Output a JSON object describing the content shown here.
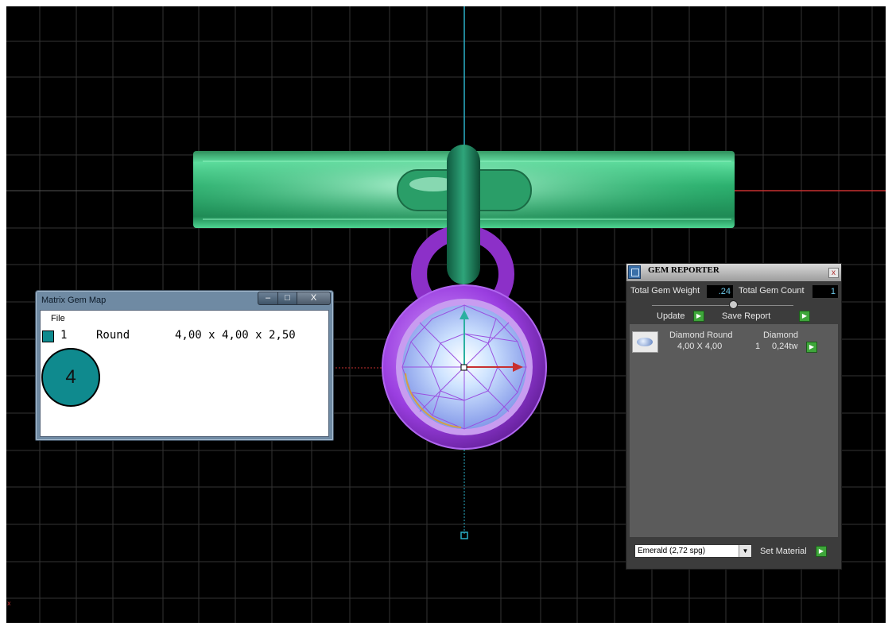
{
  "viewport": {
    "background": "#000000",
    "grid_color": "#3a3a3a",
    "axis_colors": {
      "vertical": "#2ab0c8",
      "horizontal": "#c83030"
    },
    "model_colors": {
      "shank": "#3cb878",
      "bail": "#9a3fd0",
      "bezel": "#a24be0",
      "gem_highlight": "#d6ecff"
    }
  },
  "gem_map": {
    "title": "Matrix Gem Map",
    "menu": {
      "file": "File"
    },
    "controls": {
      "minimize": "–",
      "maximize": "□",
      "close": "X"
    },
    "gems": [
      {
        "index": "1",
        "shape": "Round",
        "dims": "4,00 x 4,00 x 2,50",
        "color": "#0f8a8e"
      }
    ],
    "preview_label": "4"
  },
  "gem_reporter": {
    "title": "GEM REPORTER",
    "close": "x",
    "total_weight_label": "Total Gem Weight",
    "total_weight_value": ".24",
    "total_count_label": "Total Gem Count",
    "total_count_value": "1",
    "update_label": "Update",
    "save_report_label": "Save Report",
    "play_glyph": "▶",
    "rows": [
      {
        "name": "Diamond Round",
        "size": "4,00 X 4,00",
        "material": "Diamond",
        "count": "1",
        "weight": "0,24tw"
      }
    ],
    "material_select": {
      "value": "Emerald   (2,72 spg)",
      "arrow": "▼"
    },
    "set_material_label": "Set Material"
  }
}
